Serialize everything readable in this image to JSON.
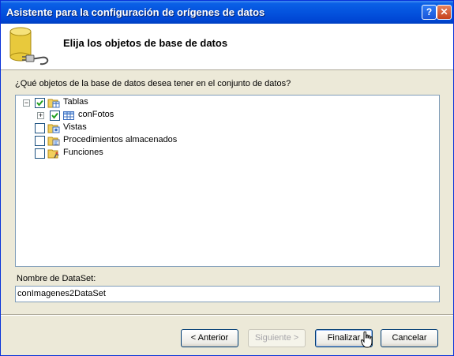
{
  "window": {
    "title": "Asistente para la configuración de orígenes de datos",
    "help_glyph": "?",
    "close_glyph": "✕"
  },
  "header": {
    "title": "Elija los objetos de base de datos",
    "icon": "database-plug-icon"
  },
  "prompt": "¿Qué objetos de la base de datos desea tener en el conjunto de datos?",
  "tree": {
    "nodes": [
      {
        "label": "Tablas",
        "checked": true,
        "expanded": true,
        "icon": "tables-folder-icon"
      },
      {
        "label": "conFotos",
        "checked": true,
        "expanded": false,
        "icon": "table-icon"
      },
      {
        "label": "Vistas",
        "checked": false,
        "icon": "views-folder-icon"
      },
      {
        "label": "Procedimientos almacenados",
        "checked": false,
        "icon": "procedures-folder-icon"
      },
      {
        "label": "Funciones",
        "checked": false,
        "icon": "functions-folder-icon"
      }
    ]
  },
  "dataset": {
    "label": "Nombre de DataSet:",
    "value": "conImagenes2DataSet"
  },
  "buttons": {
    "back": "< Anterior",
    "next": "Siguiente >",
    "finish": "Finalizar",
    "cancel": "Cancelar"
  },
  "colors": {
    "titlebar": "#0453de",
    "dialog_bg": "#ece9d8",
    "check": "#21a121"
  }
}
